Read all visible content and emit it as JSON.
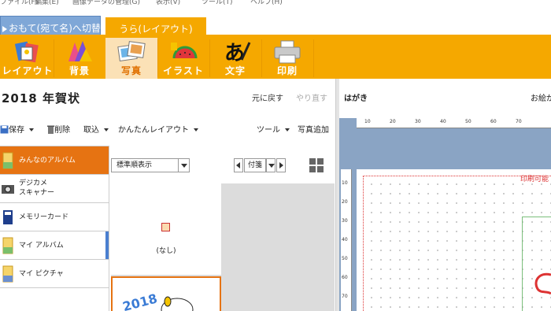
{
  "menu": {
    "items": [
      "ファイル(F)",
      "編集(E)",
      "画像データの管理(G)",
      "表示(V)",
      "ツール(T)",
      "ヘルプ(H)"
    ]
  },
  "face_switch": {
    "front_label": "おもて(宛て名)へ切替",
    "back_label": "うら(レイアウト)"
  },
  "ribbon": {
    "buttons": [
      {
        "label": "レイアウト",
        "icon": "layout-icon"
      },
      {
        "label": "背景",
        "icon": "background-icon"
      },
      {
        "label": "写真",
        "icon": "photo-icon",
        "active": true
      },
      {
        "label": "イラスト",
        "icon": "illustration-icon"
      },
      {
        "label": "文字",
        "icon": "text-icon"
      },
      {
        "label": "印刷",
        "icon": "printer-icon"
      }
    ]
  },
  "doc": {
    "title": "2018 年賀状",
    "undo": "元に戻す",
    "redo": "やり直す"
  },
  "toolbar": {
    "save": "保存",
    "delete": "削除",
    "import": "取込",
    "easy_layout": "かんたんレイアウト",
    "tools": "ツール",
    "add_photo": "写真追加"
  },
  "albums": [
    {
      "label": "みんなのアルバム",
      "active": true
    },
    {
      "label": "デジカメ",
      "label2": "スキャナー"
    },
    {
      "label": "メモリーカード"
    },
    {
      "label": "マイ アルバム"
    },
    {
      "label": "マイ ピクチャ"
    }
  ],
  "photo_pane": {
    "sort": "標準順表示",
    "tag": "付箋",
    "none_label": "(なし)"
  },
  "preview": {
    "title": "はがき",
    "help": "お絵が",
    "printable": "印刷可能",
    "ruler_h": [
      "10",
      "20",
      "30",
      "40",
      "50",
      "60",
      "70"
    ],
    "ruler_v": [
      "10",
      "20",
      "30",
      "40",
      "50",
      "60",
      "70"
    ]
  },
  "colors": {
    "ribbon": "#f5a800",
    "active_album": "#e67312",
    "face_tab": "#7fa7d7"
  }
}
